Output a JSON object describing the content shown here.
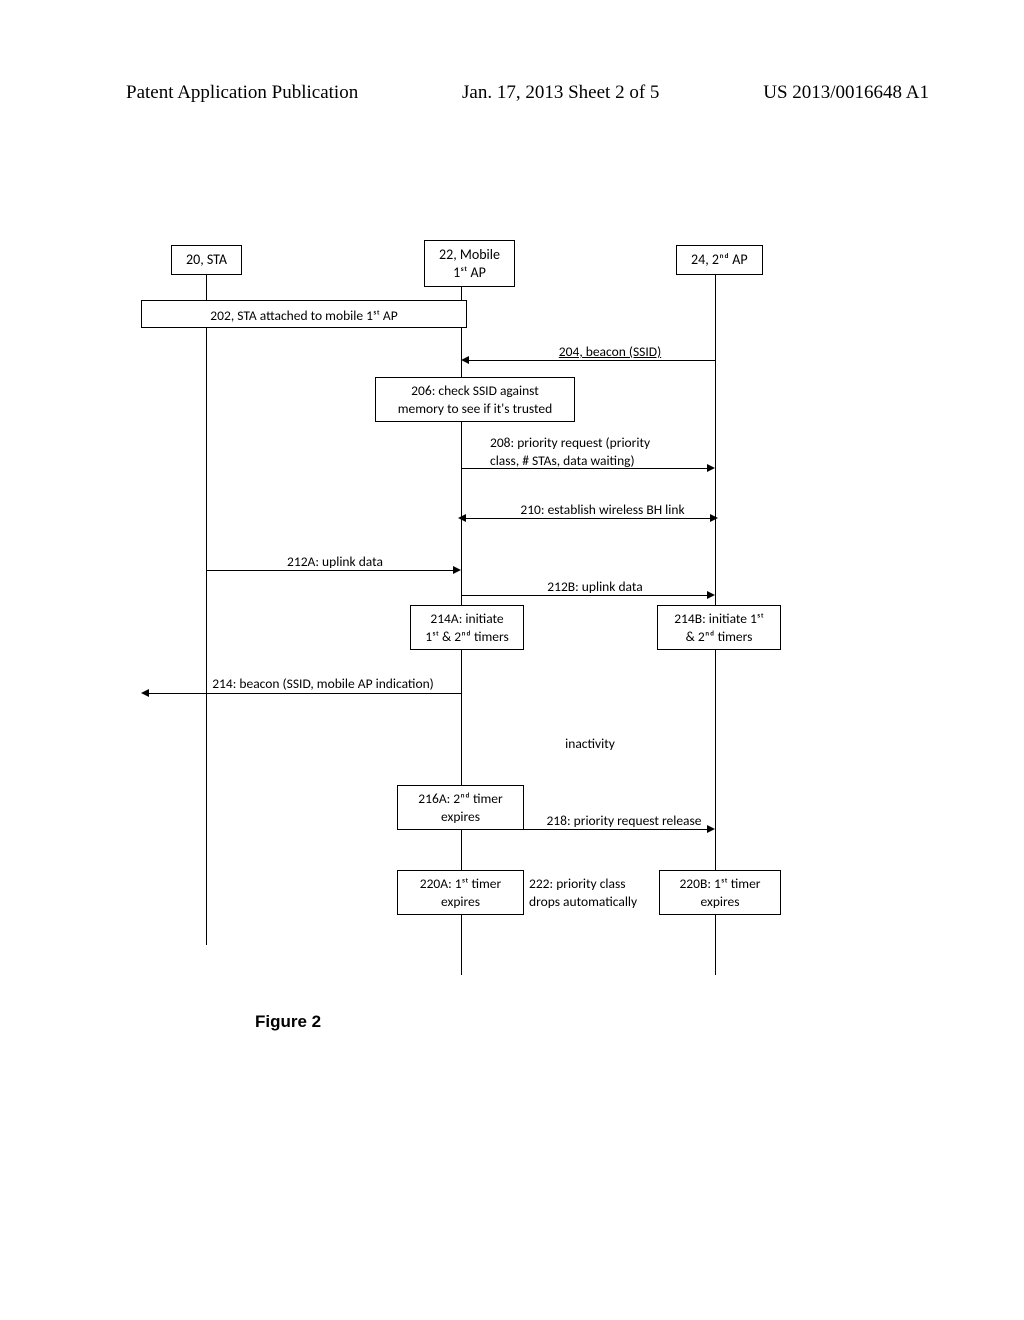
{
  "header": {
    "left": "Patent Application Publication",
    "mid": "Jan. 17, 2013  Sheet 2 of 5",
    "right": "US 2013/0016648 A1"
  },
  "actors": {
    "sta": "20, STA",
    "ap1_line1": "22, Mobile",
    "ap1_line2": "1ˢᵗ AP",
    "ap2": "24, 2ⁿᵈ AP"
  },
  "steps": {
    "s202": "202, STA attached to mobile 1ˢᵗ AP",
    "s204": "204, beacon (SSID)",
    "s206_l1": "206: check SSID against",
    "s206_l2": "memory to see if it's trusted",
    "s208_l1": "208: priority request (priority",
    "s208_l2": "class, # STAs, data waiting)",
    "s210": "210: establish wireless BH link",
    "s212a": "212A: uplink data",
    "s212b": "212B: uplink data",
    "s214a_l1": "214A: initiate",
    "s214a_l2": "1ˢᵗ & 2ⁿᵈ timers",
    "s214b_l1": "214B: initiate 1ˢᵗ",
    "s214b_l2": "& 2ⁿᵈ timers",
    "s214": "214: beacon (SSID, mobile AP indication)",
    "inactivity": "inactivity",
    "s216a_l1": "216A: 2ⁿᵈ timer",
    "s216a_l2": "expires",
    "s218": "218: priority request release",
    "s220a_l1": "220A: 1ˢᵗ timer",
    "s220a_l2": "expires",
    "s222_l1": "222: priority class",
    "s222_l2": "drops automatically",
    "s220b_l1": "220B: 1ˢᵗ timer",
    "s220b_l2": "expires"
  },
  "caption": "Figure 2"
}
